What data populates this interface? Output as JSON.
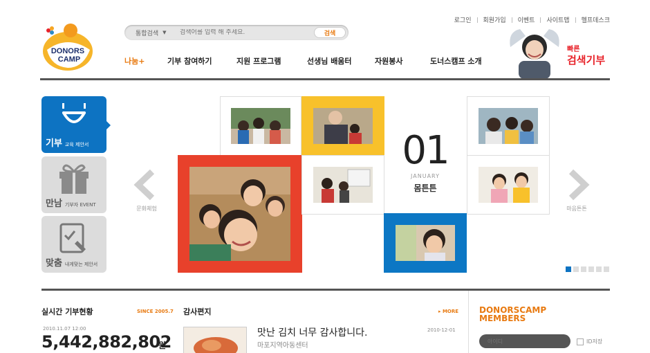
{
  "util_links": [
    "로그인",
    "회원가입",
    "이벤트",
    "사이트맵",
    "헬프데스크"
  ],
  "logo": {
    "line1": "DONORS",
    "line2": "CAMP",
    "colors": {
      "orange": "#f39a1e",
      "navy": "#1c2f6b"
    }
  },
  "search": {
    "scope": "통합검색",
    "placeholder": "검색어를 입력 해 주세요.",
    "button": "검색"
  },
  "nav": [
    "나눔+",
    "기부 참여하기",
    "지원 프로그램",
    "선생님 배움터",
    "자원봉사",
    "도너스캠프 소개"
  ],
  "promo": {
    "line1": "빠른",
    "line2": "검색기부"
  },
  "side_tiles": [
    {
      "big": "기부",
      "small": "교육 제안서",
      "icon": "smile-icon"
    },
    {
      "big": "만남",
      "small": "기부자 EVENT",
      "icon": "gift-icon"
    },
    {
      "big": "맞춤",
      "small": "내게맞는 제안서",
      "icon": "clipboard-pen-icon"
    }
  ],
  "slider": {
    "prev_label": "문화체험",
    "next_label": "마음튼튼",
    "day": "01",
    "month": "JANUARY",
    "title": "몸튼튼",
    "pages": 6,
    "current": 1
  },
  "live": {
    "title": "실시간 기부현황",
    "since": "SINCE 2005.7",
    "date": "2010.11.07 12:00",
    "amount": "5,442,882,802",
    "unit": "원"
  },
  "letters": {
    "title": "감사편지",
    "more": "▸ MORE",
    "item_title": "맛난 김치 너무 감사합니다.",
    "item_source": "마포지역아동센터",
    "item_date": "2010-12-01"
  },
  "members": {
    "title_line1": "DONORSCAMP",
    "title_line2": "MEMBERS",
    "id_placeholder": "아이디",
    "save_id": "ID저장"
  },
  "colors": {
    "accent": "#e87a11",
    "blue": "#0d73c2",
    "yellow": "#f8c12b",
    "red": "#e8412b",
    "dark": "#555555"
  }
}
